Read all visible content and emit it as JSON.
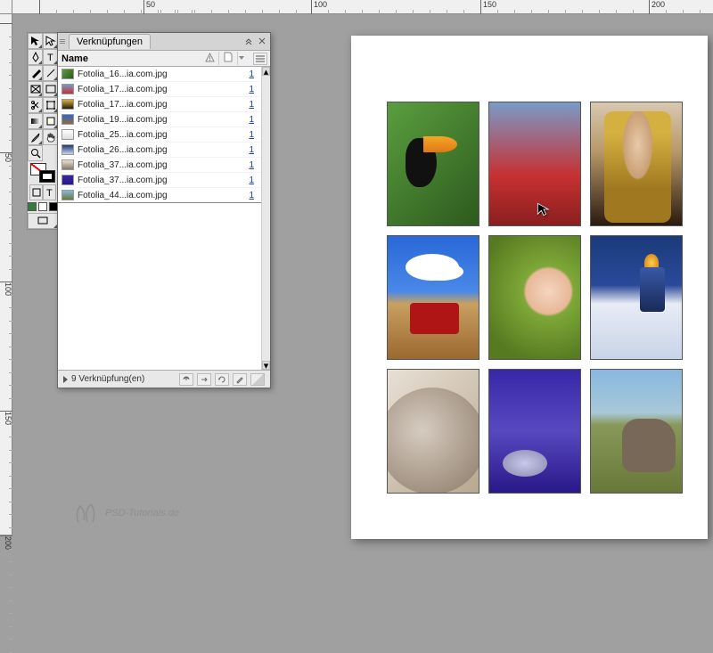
{
  "panel": {
    "title": "Verknüpfungen",
    "columns": {
      "name": "Name"
    },
    "links": [
      {
        "name": "Fotolia_16...ia.com.jpg",
        "page": "1",
        "thumb": "linear-gradient(135deg,#5a9e3e,#2d5a1e)"
      },
      {
        "name": "Fotolia_17...ia.com.jpg",
        "page": "1",
        "thumb": "linear-gradient(#7a9ac8,#c73030)"
      },
      {
        "name": "Fotolia_17...ia.com.jpg",
        "page": "1",
        "thumb": "linear-gradient(#d4b040,#2a1a10)"
      },
      {
        "name": "Fotolia_19...ia.com.jpg",
        "page": "1",
        "thumb": "linear-gradient(#2868d8,#9a6830)"
      },
      {
        "name": "Fotolia_25...ia.com.jpg",
        "page": "1",
        "thumb": "linear-gradient(#fff,#ddd)"
      },
      {
        "name": "Fotolia_26...ia.com.jpg",
        "page": "1",
        "thumb": "linear-gradient(#1a3a7a,#c8d4e8)"
      },
      {
        "name": "Fotolia_37...ia.com.jpg",
        "page": "1",
        "thumb": "linear-gradient(#e8e0d5,#887868)"
      },
      {
        "name": "Fotolia_37...ia.com.jpg",
        "page": "1",
        "thumb": "linear-gradient(#3828a8,#281888)"
      },
      {
        "name": "Fotolia_44...ia.com.jpg",
        "page": "1",
        "thumb": "linear-gradient(#88b8e0,#687838)"
      }
    ],
    "status": "9 Verknüpfung(en)"
  },
  "ruler": {
    "h": [
      "50",
      "100",
      "150",
      "200"
    ],
    "v": [
      "50",
      "100",
      "150",
      "200"
    ]
  },
  "watermark": "PSD-Tutorials.de"
}
